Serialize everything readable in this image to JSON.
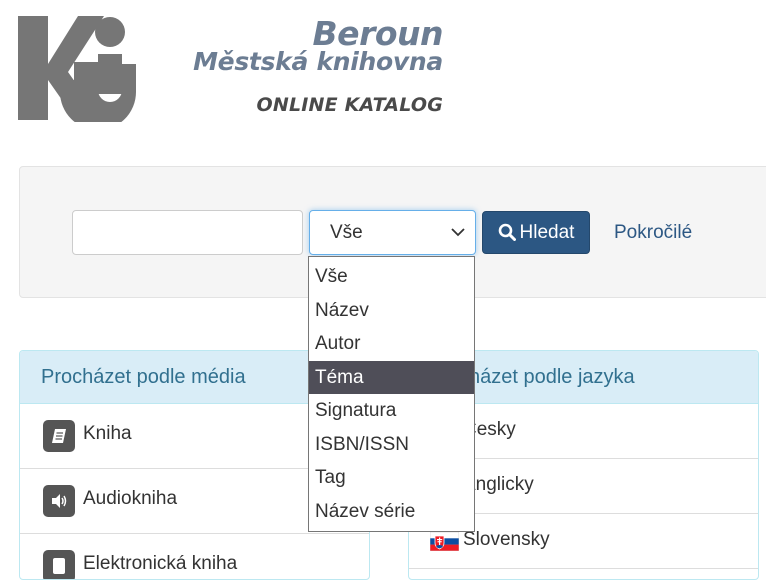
{
  "header": {
    "city": "Beroun",
    "library": "Městská knihovna",
    "catalog": "ONLINE KATALOG"
  },
  "search": {
    "query_value": "",
    "scope_selected": "Vše",
    "submit_label": "Hledat",
    "advanced_label": "Pokročilé",
    "scope_options": [
      "Vše",
      "Název",
      "Autor",
      "Téma",
      "Signatura",
      "ISBN/ISSN",
      "Tag",
      "Název série"
    ],
    "highlighted_option": "Téma"
  },
  "browse_media": {
    "heading": "Procházet podle média",
    "items": [
      {
        "label": "Kniha",
        "icon": "book-icon"
      },
      {
        "label": "Audiokniha",
        "icon": "speaker-icon"
      },
      {
        "label": "Elektronická kniha",
        "icon": "ebook-icon"
      }
    ]
  },
  "browse_language": {
    "heading_visible": "cházet podle jazyka",
    "items": [
      {
        "label": "Česky"
      },
      {
        "label": "Anglicky"
      },
      {
        "label": "Slovensky",
        "icon": "flag-sk-icon"
      }
    ]
  },
  "colors": {
    "brand_gray": "#6c7d93",
    "button_blue": "#2c5783",
    "panel_heading_bg": "#d9edf7",
    "panel_heading_text": "#31708f",
    "dropdown_highlight": "#4f4e58"
  }
}
